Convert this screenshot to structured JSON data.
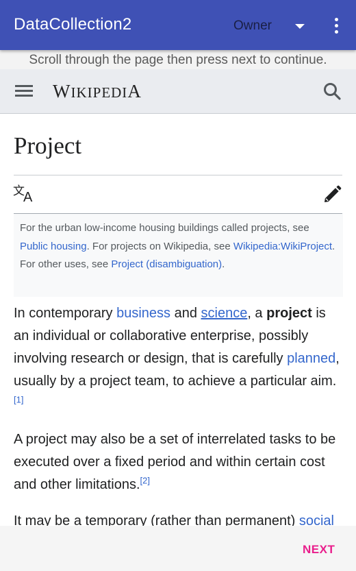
{
  "appbar": {
    "title": "DataCollection2",
    "role": "Owner",
    "menu_icon": "more-vert-icon",
    "dropdown_icon": "caret-down-icon"
  },
  "instruction": "Scroll through the page then press next to continue.",
  "wiki": {
    "logo_first": "W",
    "logo_mid": "IKIPEDI",
    "logo_last": "A",
    "menu_icon": "hamburger-icon",
    "search_icon": "search-icon"
  },
  "page_title": "Project",
  "hatnote": {
    "t1": "For the urban low-income housing buildings called projects, see ",
    "l1": "Public housing",
    "t2": ". For projects on Wikipedia, see ",
    "l2": "Wikipedia:WikiProject",
    "t3": ". For other uses, see ",
    "l3": "Project (disambiguation)",
    "t4": "."
  },
  "para1": {
    "t1": "In contemporary ",
    "l1": "business",
    "t2": " and ",
    "l2": "science",
    "t3": ", a ",
    "b1": "project",
    "t4": " is an individual or collaborative enterprise, possibly involving research or design, that is carefully ",
    "l3": "planned",
    "t5": ", usually by a project team, to achieve a particular aim.",
    "ref": "[1]"
  },
  "para2": {
    "t1": "A project may also be a set of interrelated tasks to be executed over a fixed period and within certain cost and other limitations.",
    "ref": "[2]"
  },
  "para3": {
    "t1": "It may be a temporary (rather than permanent) ",
    "l1": "social"
  },
  "footer": {
    "next_label": "NEXT"
  },
  "colors": {
    "appbar": "#3f51b5",
    "link": "#3366cc",
    "next": "#e91e8c"
  }
}
